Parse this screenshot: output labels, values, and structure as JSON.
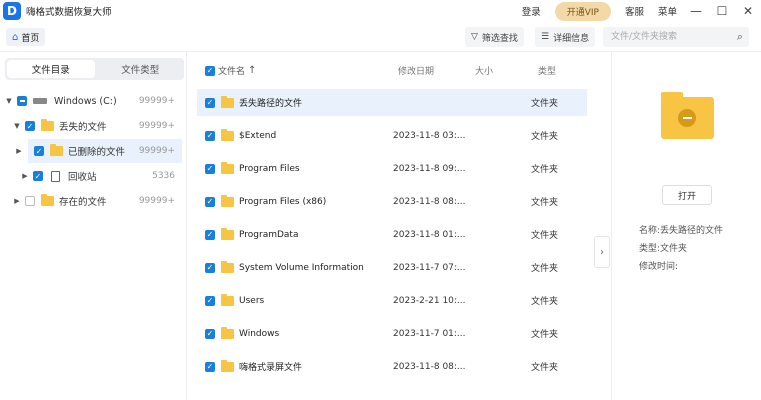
{
  "app": {
    "logo_letter": "D",
    "title": "嗨格式数据恢复大师"
  },
  "titlebar": {
    "login": "登录",
    "vip": "开通VIP",
    "support": "客服",
    "menu": "菜单",
    "min": "—",
    "max": "☐",
    "close": "✕"
  },
  "toolbar": {
    "home": "首页",
    "filter": "筛选查找",
    "details": "详细信息",
    "search_placeholder": "文件/文件夹搜索"
  },
  "left": {
    "tabs": [
      "文件目录",
      "文件类型"
    ],
    "tree": [
      {
        "label": "Windows (C:)",
        "count": "99999+",
        "check": "partial",
        "expanded": true,
        "icon": "drive-icon"
      },
      {
        "label": "丢失的文件",
        "count": "99999+",
        "check": "on",
        "expanded": true,
        "icon": "folder-lost-icon"
      },
      {
        "label": "已删除的文件",
        "count": "99999+",
        "check": "on",
        "expanded": false,
        "icon": "folder-deleted-icon"
      },
      {
        "label": "回收站",
        "count": "5336",
        "check": "on",
        "expanded": false,
        "icon": "recycle-bin-icon"
      },
      {
        "label": "存在的文件",
        "count": "99999+",
        "check": "off",
        "expanded": false,
        "icon": "folder-icon"
      }
    ]
  },
  "list": {
    "headers": {
      "name": "文件名",
      "date": "修改日期",
      "size": "大小",
      "type": "类型"
    },
    "rows": [
      {
        "name": "丢失路径的文件",
        "date": "",
        "type": "文件夹"
      },
      {
        "name": "$Extend",
        "date": "2023-11-8 03:...",
        "type": "文件夹"
      },
      {
        "name": "Program Files",
        "date": "2023-11-8 09:...",
        "type": "文件夹"
      },
      {
        "name": "Program Files (x86)",
        "date": "2023-11-8 08:...",
        "type": "文件夹"
      },
      {
        "name": "ProgramData",
        "date": "2023-11-8 01:...",
        "type": "文件夹"
      },
      {
        "name": "System Volume Information",
        "date": "2023-11-7 07:...",
        "type": "文件夹"
      },
      {
        "name": "Users",
        "date": "2023-2-21 10:...",
        "type": "文件夹"
      },
      {
        "name": "Windows",
        "date": "2023-11-7 01:...",
        "type": "文件夹"
      },
      {
        "name": "嗨格式录屏文件",
        "date": "2023-11-8 08:...",
        "type": "文件夹"
      }
    ]
  },
  "detail": {
    "open": "打开",
    "name_line": "名称:丢失路径的文件",
    "type_line": "类型:文件夹",
    "mtime_line": "修改时间:"
  },
  "colors": {
    "accent": "#1a7fd8",
    "folder": "#f7c443",
    "vip": "#f3d9a8",
    "selected_row": "#e8f1fc"
  }
}
